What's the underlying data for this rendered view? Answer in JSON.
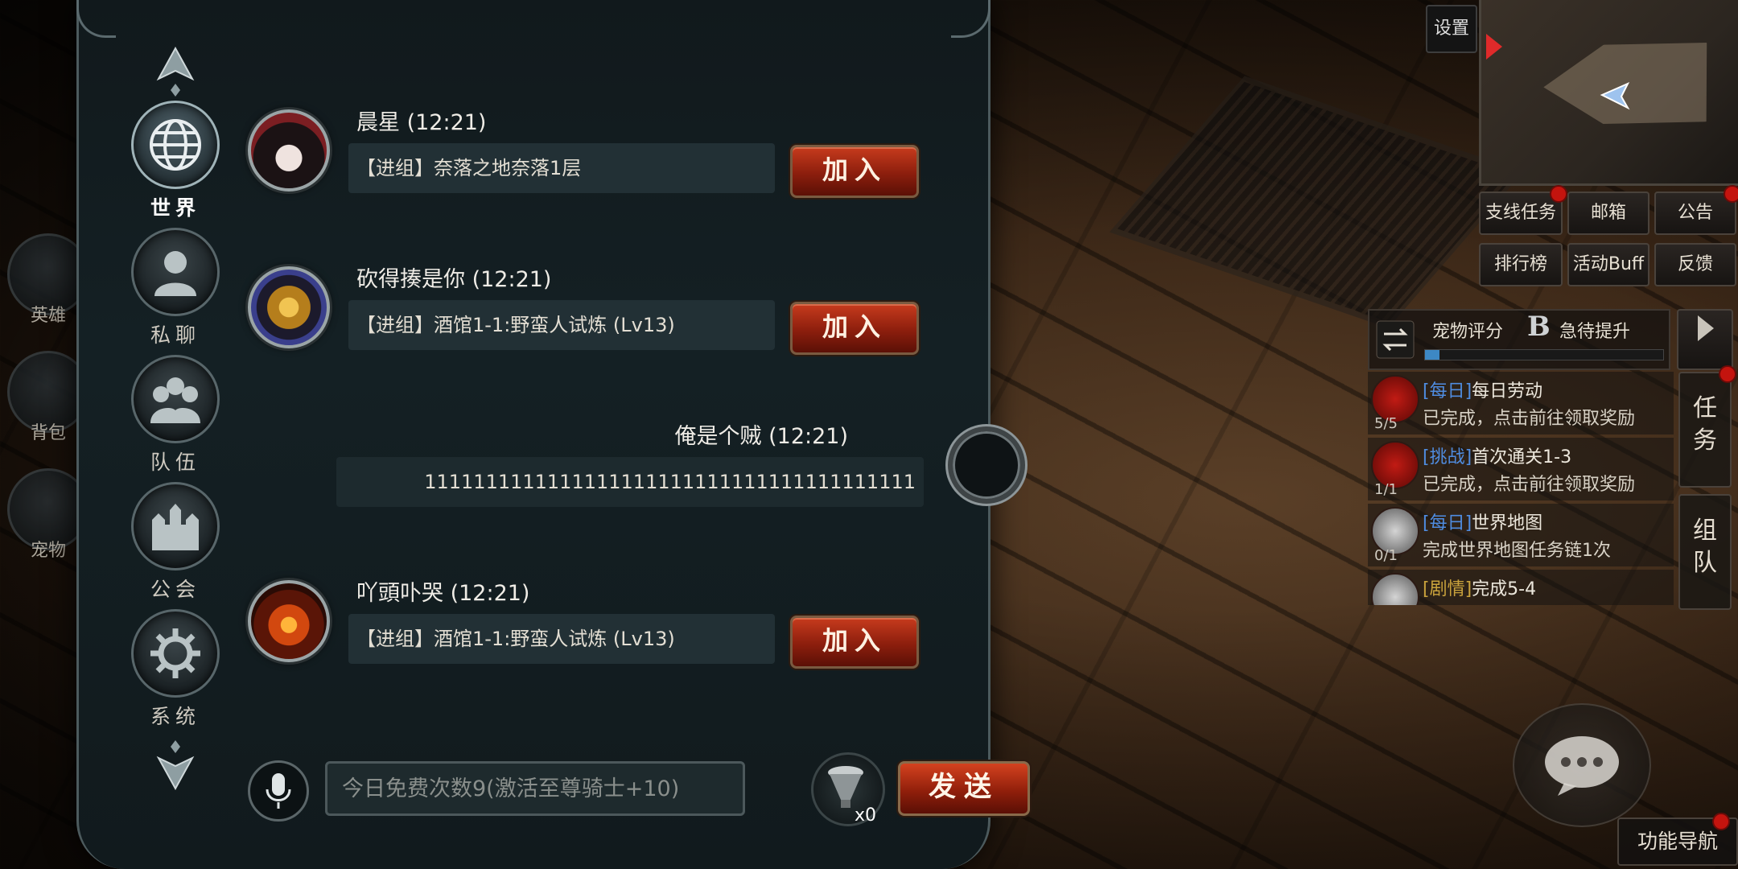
{
  "left_rail": {
    "items": [
      {
        "label": "英雄",
        "icon": "helmet-icon"
      },
      {
        "label": "背包",
        "icon": "bag-icon"
      },
      {
        "label": "宠物",
        "icon": "paw-icon"
      }
    ]
  },
  "side_nav": {
    "items": [
      {
        "label": "世界",
        "icon": "globe-icon",
        "active": true
      },
      {
        "label": "私聊",
        "icon": "person-icon",
        "active": false
      },
      {
        "label": "队伍",
        "icon": "team-icon",
        "active": false
      },
      {
        "label": "公会",
        "icon": "castle-icon",
        "active": false
      },
      {
        "label": "系统",
        "icon": "gear-icon",
        "active": false
      }
    ]
  },
  "messages": [
    {
      "name": "晨星 (12:21)",
      "text": "【进组】奈落之地奈落1层",
      "button": "加入",
      "avatar": "female-avatar"
    },
    {
      "name": "砍得揍是你 (12:21)",
      "text": "【进组】酒馆1-1:野蛮人试炼 (Lv13)",
      "button": "加入",
      "avatar": "golden-helmet-avatar"
    },
    {
      "name": "俺是个贼 (12:21)",
      "text": "1111111111111111111111111111111111111111",
      "self": true
    },
    {
      "name": "吖頭卟哭 (12:21)",
      "text": "【进组】酒馆1-1:野蛮人试炼 (Lv13)",
      "button": "加入",
      "avatar": "fire-ring-avatar"
    }
  ],
  "input": {
    "placeholder": "今日免费次数9(激活至尊骑士+10)",
    "item_count": "x0",
    "send_label": "发送"
  },
  "hud": {
    "settings_label": "设置",
    "buttons_row1": [
      "支线任务",
      "邮箱",
      "公告"
    ],
    "buttons_row2": [
      "排行榜",
      "活动Buff",
      "反馈"
    ],
    "pet": {
      "label": "宠物评分",
      "grade": "B",
      "action": "急待提升",
      "progress": 0.06
    },
    "quests": [
      {
        "tag": "[每日]",
        "title": "每日劳动",
        "desc": "已完成，点击前往领取奖励",
        "count": "5/5"
      },
      {
        "tag": "[挑战]",
        "title": "首次通关1-3",
        "desc": "已完成，点击前往领取奖励",
        "count": "1/1"
      },
      {
        "tag": "[每日]",
        "title": "世界地图",
        "desc": "完成世界地图任务链1次",
        "count": "0/1"
      },
      {
        "tag": "[剧情]",
        "title": "完成5-4",
        "desc": "",
        "count": ""
      }
    ],
    "vtabs": [
      "任务",
      "组队"
    ],
    "func_nav": "功能导航"
  },
  "colors": {
    "accent_red": "#c73b1d",
    "panel_bg": "#142024",
    "quest_tag": "#4f8ce0"
  }
}
